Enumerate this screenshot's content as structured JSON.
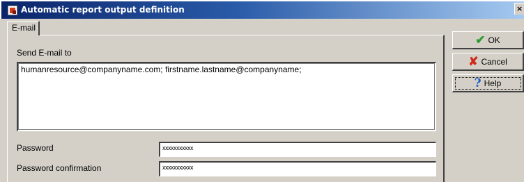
{
  "window": {
    "title": "Automatic report output definition",
    "close_glyph": "×"
  },
  "tabs": [
    {
      "label": "E-mail",
      "active": true
    }
  ],
  "email": {
    "send_to_label": "Send E-mail to",
    "recipients": "humanresource@companyname.com; firstname.lastname@companyname;"
  },
  "password": {
    "label": "Password",
    "value": "xxxxxxxxxxx"
  },
  "password_confirmation": {
    "label": "Password confirmation",
    "value": "xxxxxxxxxxx"
  },
  "buttons": {
    "ok": {
      "label": "OK",
      "icon": "checkmark-icon",
      "glyph": "✔",
      "color": "#2f9a2f"
    },
    "cancel": {
      "label": "Cancel",
      "icon": "cross-icon",
      "glyph": "✘",
      "color": "#d02a1a"
    },
    "help": {
      "label": "Help",
      "icon": "question-mark-icon",
      "glyph": "?",
      "color": "#1e5ec8"
    }
  },
  "colors": {
    "titlebar_start": "#0a246a",
    "titlebar_end": "#a6caf0",
    "dialog_background": "#d4d0c8"
  }
}
